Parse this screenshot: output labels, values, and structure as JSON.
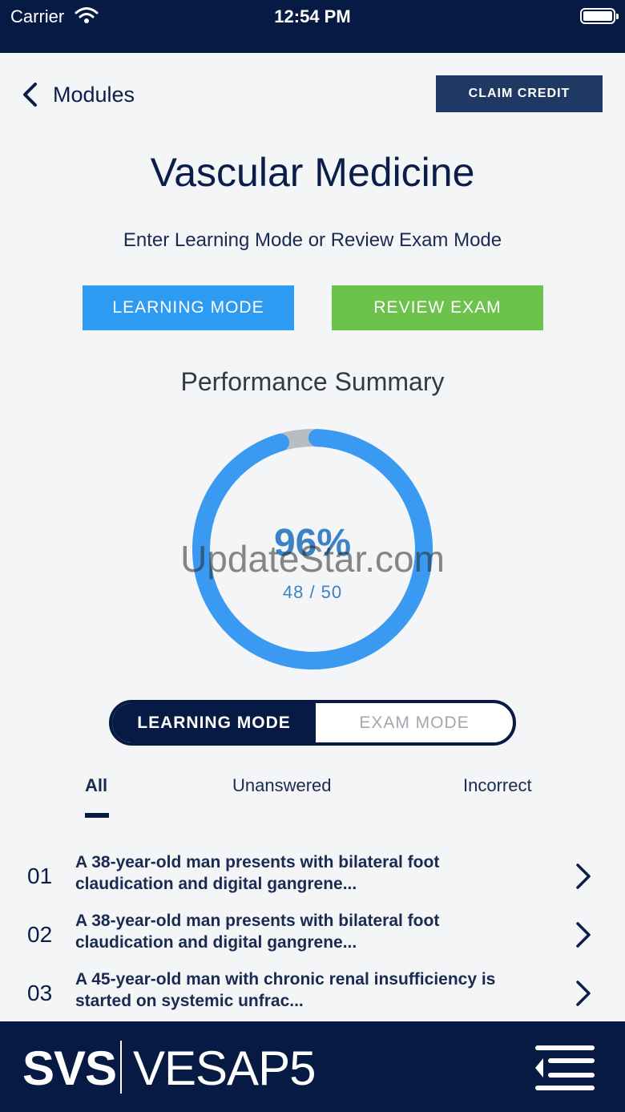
{
  "status_bar": {
    "carrier": "Carrier",
    "time": "12:54 PM"
  },
  "nav": {
    "back_label": "Modules",
    "claim_label": "CLAIM CREDIT"
  },
  "page": {
    "title": "Vascular Medicine",
    "subtitle": "Enter Learning Mode or Review Exam Mode",
    "learning_button": "LEARNING MODE",
    "review_button": "REVIEW EXAM"
  },
  "performance": {
    "title": "Performance Summary",
    "percent_label": "96%",
    "count_label": "48 / 50",
    "fraction": 0.96
  },
  "watermark": "UpdateStar.com",
  "mode_toggle": {
    "learning": "LEARNING MODE",
    "exam": "EXAM MODE",
    "selected": "learning"
  },
  "filters": {
    "all": "All",
    "unanswered": "Unanswered",
    "incorrect": "Incorrect",
    "selected": "all"
  },
  "questions": [
    {
      "num": "01",
      "line1": "A 38-year-old man presents with bilateral foot",
      "line2": "claudication and digital gangrene..."
    },
    {
      "num": "02",
      "line1": "A 38-year-old man presents with bilateral foot",
      "line2": "claudication and digital gangrene..."
    },
    {
      "num": "03",
      "line1": "A 45-year-old man with chronic renal insufficiency is",
      "line2": "started on systemic unfrac..."
    }
  ],
  "footer": {
    "logo_left": "SVS",
    "logo_right": "VESAP5"
  },
  "colors": {
    "navy": "#061a44",
    "learning_blue": "#2e9bf2",
    "review_green": "#6cc24a",
    "ring_blue": "#3a9af2",
    "ring_gap": "#b9bcc0"
  },
  "icons": {
    "back": "chevron-left-icon",
    "question_arrow": "chevron-right-icon",
    "menu": "menu-collapse-icon",
    "wifi": "wifi-icon",
    "battery": "battery-icon"
  }
}
